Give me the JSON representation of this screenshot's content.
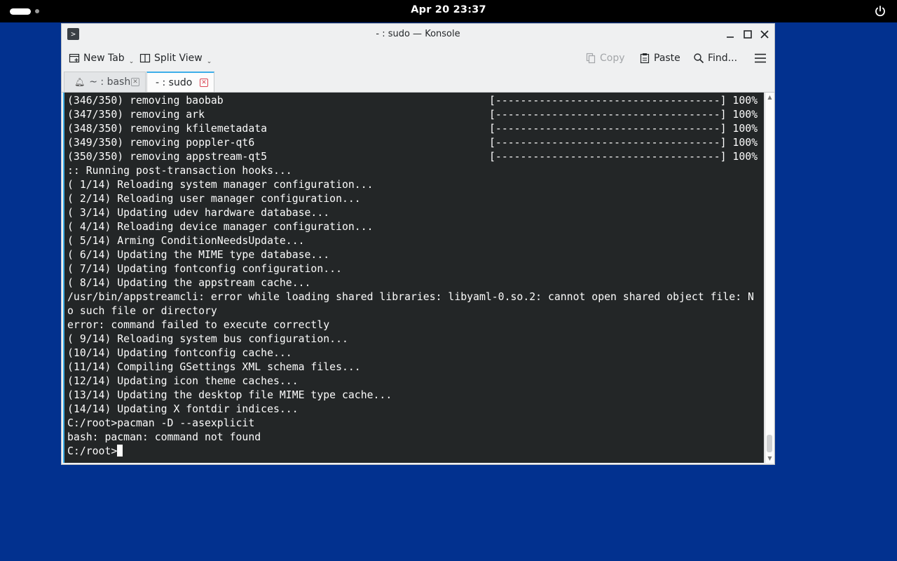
{
  "topbar": {
    "clock": "Apr 20  23:37"
  },
  "window": {
    "title": "- : sudo — Konsole"
  },
  "toolbar": {
    "new_tab": "New Tab",
    "split_view": "Split View",
    "copy": "Copy",
    "paste": "Paste",
    "find": "Find..."
  },
  "tabs": [
    {
      "label": "~ : bash"
    },
    {
      "label": "- : sudo"
    }
  ],
  "terminal": {
    "progress_bar": "[------------------------------------] 100%",
    "lines": [
      "(346/350) removing baobab",
      "(347/350) removing ark",
      "(348/350) removing kfilemetadata",
      "(349/350) removing poppler-qt6",
      "(350/350) removing appstream-qt5",
      ":: Running post-transaction hooks...",
      "( 1/14) Reloading system manager configuration...",
      "( 2/14) Reloading user manager configuration...",
      "( 3/14) Updating udev hardware database...",
      "( 4/14) Reloading device manager configuration...",
      "( 5/14) Arming ConditionNeedsUpdate...",
      "( 6/14) Updating the MIME type database...",
      "( 7/14) Updating fontconfig configuration...",
      "( 8/14) Updating the appstream cache...",
      "/usr/bin/appstreamcli: error while loading shared libraries: libyaml-0.so.2: cannot open shared object file: N",
      "o such file or directory",
      "error: command failed to execute correctly",
      "( 9/14) Reloading system bus configuration...",
      "(10/14) Updating fontconfig cache...",
      "(11/14) Compiling GSettings XML schema files...",
      "(12/14) Updating icon theme caches...",
      "(13/14) Updating the desktop file MIME type cache...",
      "(14/14) Updating X fontdir indices...",
      "C:/root>pacman -D --asexplicit",
      "bash: pacman: command not found"
    ],
    "prompt": "C:/root>"
  },
  "colors": {
    "desktop": "#02318f",
    "terminal_bg": "#232627",
    "terminal_fg": "#fcfcfc",
    "accent": "#3daee9",
    "close_tab": "#da4453"
  }
}
